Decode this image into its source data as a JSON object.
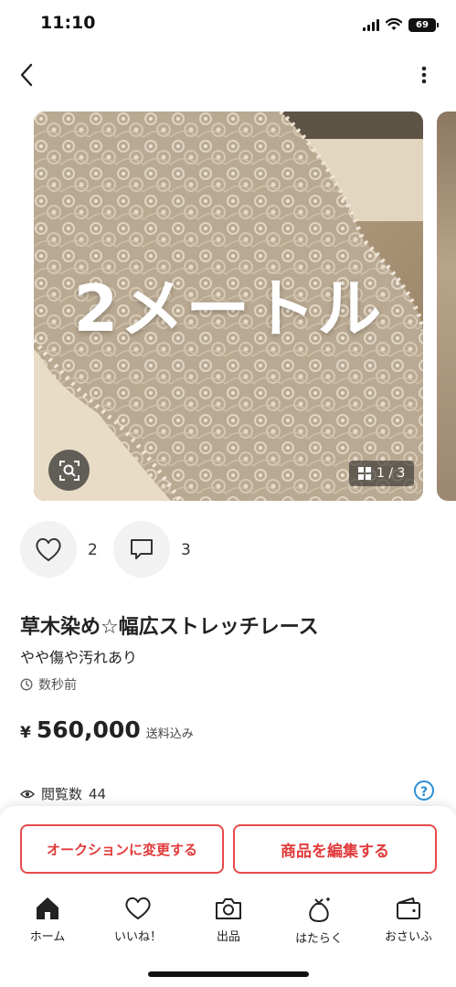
{
  "status_bar": {
    "time": "11:10",
    "battery": "69"
  },
  "image": {
    "overlay_text": "2メートル",
    "counter": "1 / 3"
  },
  "reactions": {
    "likes": "2",
    "comments": "3"
  },
  "item": {
    "title": "草木染め☆幅広ストレッチレース",
    "condition": "やや傷や汚れあり",
    "posted": "数秒前",
    "currency": "¥",
    "price": "560,000",
    "shipping": "送料込み",
    "views_label": "閲覧数",
    "views": "44"
  },
  "actions": {
    "auction_label": "オークションに変更する",
    "edit_label": "商品を編集する"
  },
  "tabbar": {
    "items": [
      {
        "label": "ホーム",
        "icon": "home-icon"
      },
      {
        "label": "いいね！",
        "icon": "heart-icon"
      },
      {
        "label": "出品",
        "icon": "camera-icon"
      },
      {
        "label": "はたらく",
        "icon": "money-bag-icon"
      },
      {
        "label": "おさいふ",
        "icon": "wallet-icon"
      }
    ]
  },
  "colors": {
    "accent": "#e84a4a",
    "help": "#2b8fd6"
  }
}
